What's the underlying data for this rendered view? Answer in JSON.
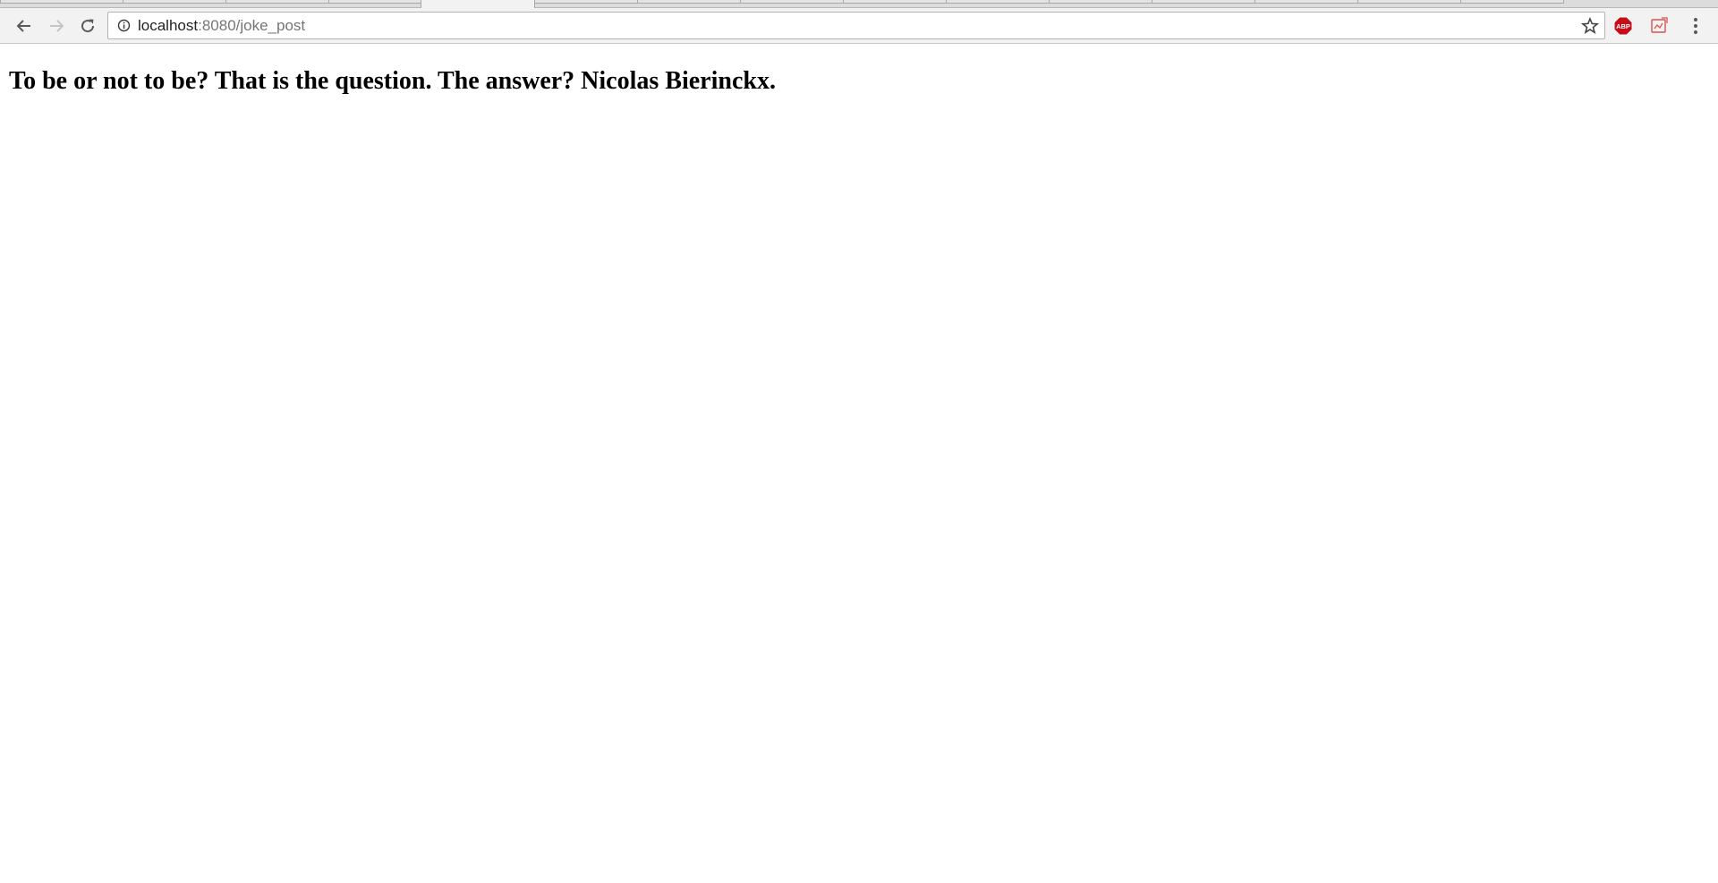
{
  "browser": {
    "url_host": "localhost",
    "url_rest": ":8080/joke_post",
    "icons": {
      "back": "back-arrow-icon",
      "forward": "forward-arrow-icon",
      "reload": "reload-icon",
      "site_info": "info-icon",
      "bookmark": "star-icon",
      "adblock": "abp-icon",
      "extension": "extension-icon",
      "menu": "kebab-menu-icon"
    },
    "extensions": {
      "adblock_label": "ABP"
    }
  },
  "page": {
    "heading": "To be or not to be? That is the question. The answer? Nicolas Bierinckx."
  },
  "colors": {
    "adblock_red": "#c70d17",
    "extension_red": "#d9534f",
    "text": "#000000"
  }
}
